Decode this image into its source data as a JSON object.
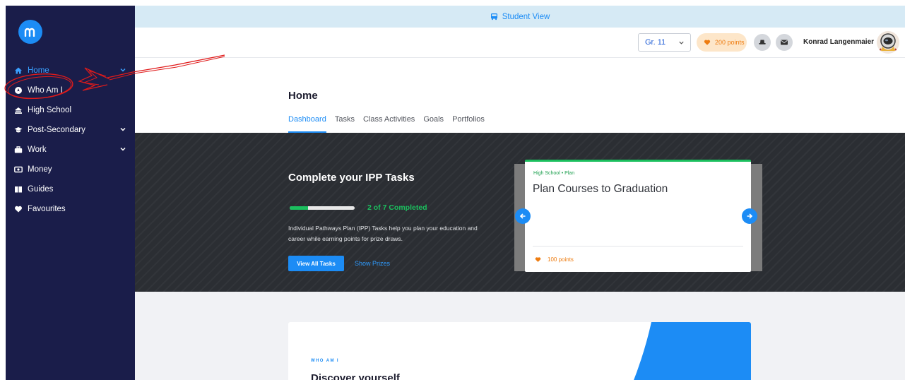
{
  "topbar": {
    "label": "Student View"
  },
  "sidebar": {
    "items": [
      {
        "label": "Home",
        "icon": "home-icon",
        "active": true,
        "has_chevron": true
      },
      {
        "label": "Who Am I",
        "icon": "compass-icon",
        "active": false,
        "has_chevron": false
      },
      {
        "label": "High School",
        "icon": "school-icon",
        "active": false,
        "has_chevron": false
      },
      {
        "label": "Post-Secondary",
        "icon": "graduation-cap-icon",
        "active": false,
        "has_chevron": true
      },
      {
        "label": "Work",
        "icon": "briefcase-icon",
        "active": false,
        "has_chevron": true
      },
      {
        "label": "Money",
        "icon": "money-icon",
        "active": false,
        "has_chevron": false
      },
      {
        "label": "Guides",
        "icon": "book-icon",
        "active": false,
        "has_chevron": false
      },
      {
        "label": "Favourites",
        "icon": "heart-icon",
        "active": false,
        "has_chevron": false
      }
    ]
  },
  "header": {
    "grade": "Gr. 11",
    "points": "200 points",
    "user_name": "Konrad Langenmaier"
  },
  "page": {
    "title": "Home",
    "tabs": [
      {
        "label": "Dashboard",
        "active": true
      },
      {
        "label": "Tasks",
        "active": false
      },
      {
        "label": "Class Activities",
        "active": false
      },
      {
        "label": "Goals",
        "active": false
      },
      {
        "label": "Portfolios",
        "active": false
      }
    ]
  },
  "banner": {
    "title": "Complete your IPP Tasks",
    "progress_text": "2 of 7 Completed",
    "progress_fraction": 0.286,
    "description": "Individual Pathways Plan (IPP) Tasks help you plan your education and career while earning points for prize draws.",
    "primary_button": "View All Tasks",
    "link_button": "Show Prizes"
  },
  "task_card": {
    "eyebrow": "High School • Plan",
    "title": "Plan Courses to Graduation",
    "points": "100 points"
  },
  "who_card": {
    "eyebrow": "WHO AM I",
    "heading": "Discover yourself"
  },
  "colors": {
    "sidebar_bg": "#1a1d4a",
    "accent": "#1c8cf5",
    "success": "#1bbf5e",
    "points": "#ee7c10",
    "annotation": "#e01b1b"
  }
}
